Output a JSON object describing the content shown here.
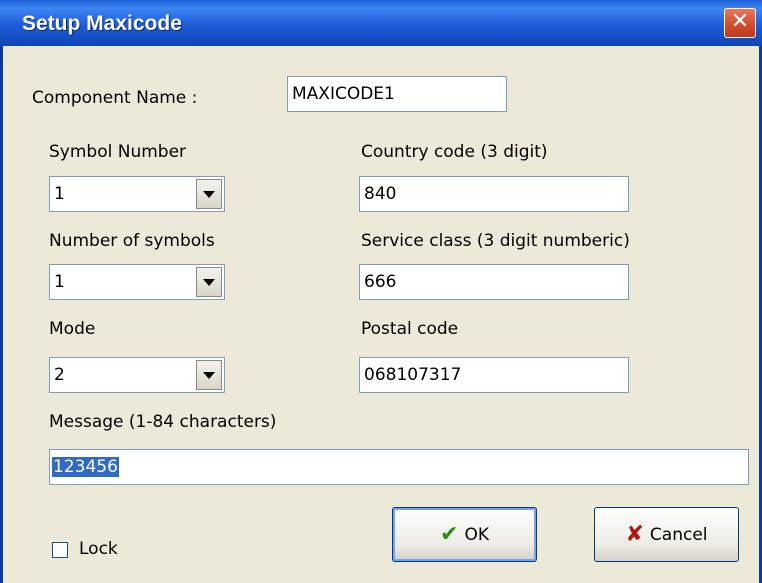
{
  "window": {
    "title": "Setup Maxicode",
    "close_glyph": "✕"
  },
  "component": {
    "label": "Component Name :",
    "value": "MAXICODE1"
  },
  "symbol_number": {
    "label": "Symbol Number",
    "value": "1"
  },
  "number_of_symbols": {
    "label": "Number of symbols",
    "value": "1"
  },
  "mode": {
    "label": "Mode",
    "value": "2"
  },
  "country_code": {
    "label": "Country code (3 digit)",
    "value": "840"
  },
  "service_class": {
    "label": "Service class (3 digit numberic)",
    "value": "666"
  },
  "postal_code": {
    "label": "Postal code",
    "value": "068107317"
  },
  "message": {
    "label": "Message (1-84 characters)",
    "value": "123456"
  },
  "lock": {
    "label": "Lock",
    "checked": false
  },
  "buttons": {
    "ok": {
      "label": "OK",
      "icon": "checkmark-icon",
      "icon_glyph": "✔",
      "icon_color": "#2E8B12"
    },
    "cancel": {
      "label": "Cancel",
      "icon": "x-icon",
      "icon_glyph": "✘",
      "icon_color": "#B0170D"
    }
  },
  "colors": {
    "titlebar": "#1E5BD8",
    "dialog_bg": "#ECE9D8",
    "selection": "#316AC5"
  }
}
